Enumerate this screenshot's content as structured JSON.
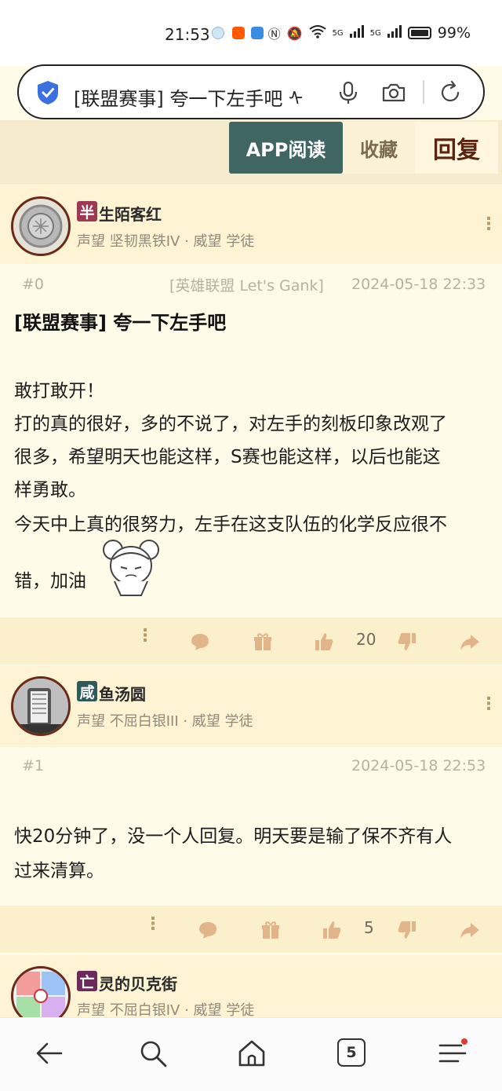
{
  "status_bar": {
    "time": "21:53",
    "network": "5G",
    "battery": "99%"
  },
  "address_bar": {
    "text": "[联盟赛事] 夸一下左手吧 ᠰ"
  },
  "top_actions": {
    "app_read": "APP阅读",
    "favorite": "收藏",
    "reply": "回复"
  },
  "posts": [
    {
      "user": {
        "badge": "半",
        "name": "生陌客红",
        "meta": "声望 坚韧黑铁IV · 威望 学徒"
      },
      "floor": "#0",
      "forum": "[英雄联盟 Let's Gank]",
      "time": "2024-05-18 22:33",
      "title": "[联盟赛事] 夸一下左手吧",
      "lines": [
        "敢打敢开！",
        "打的真的很好，多的不说了，对左手的刻板印象改观了",
        "很多，希望明天也能这样，S赛也能这样，以后也能这",
        "样勇敢。",
        "今天中上真的很努力，左手在这支队伍的化学反应很不",
        "错，加油"
      ],
      "likes": "20"
    },
    {
      "user": {
        "badge": "咸",
        "name": "鱼汤圆",
        "meta": "声望 不屈白银III · 威望 学徒"
      },
      "floor": "#1",
      "time": "2024-05-18 22:53",
      "lines": [
        "快20分钟了，没一个人回复。明天要是输了保不齐有人",
        "过来清算。"
      ],
      "likes": "5"
    },
    {
      "user": {
        "badge": "亡",
        "name": "灵的贝克街",
        "meta": "声望 不屈白银IV · 威望 学徒"
      }
    }
  ],
  "bottom_nav": {
    "tab_count": "5"
  },
  "colors": {
    "accent": "#3f6663",
    "reply": "#5a2410",
    "bg": "#fffbe9"
  }
}
